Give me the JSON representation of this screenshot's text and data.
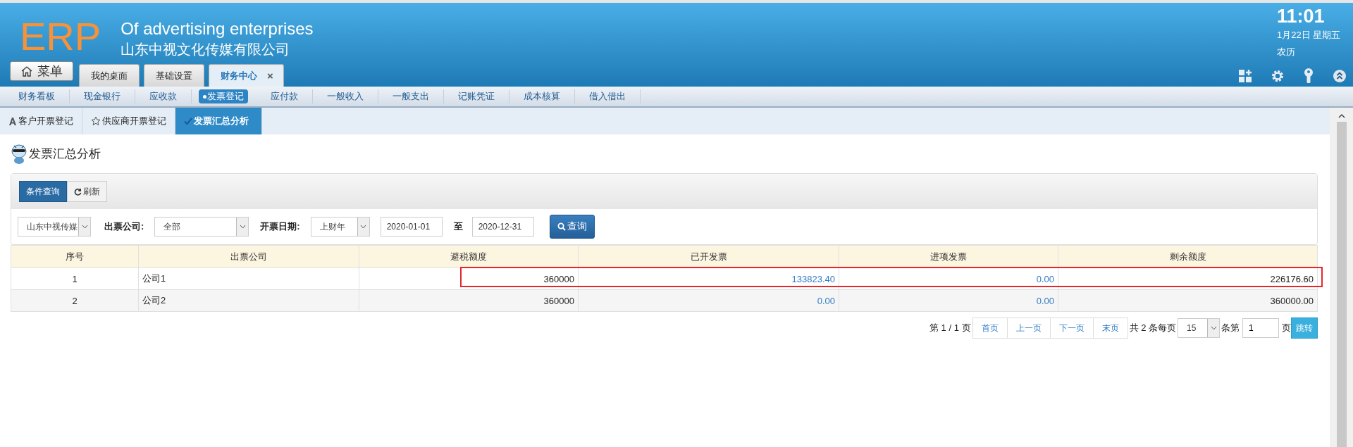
{
  "header": {
    "logo": "ERP",
    "title": "Of advertising enterprises",
    "company": "山东中视文化传媒有限公司",
    "menu_button": "菜单",
    "clock": {
      "time": "11:01",
      "date": "1月22日 星期五",
      "lunar": "农历"
    }
  },
  "top_tabs": [
    {
      "label": "我的桌面",
      "selected": false,
      "closable": false
    },
    {
      "label": "基础设置",
      "selected": false,
      "closable": false
    },
    {
      "label": "财务中心",
      "selected": true,
      "closable": true
    }
  ],
  "close_mark": "×",
  "nav": [
    {
      "label": "财务看板",
      "selected": false
    },
    {
      "label": "现金银行",
      "selected": false
    },
    {
      "label": "应收款",
      "selected": false
    },
    {
      "label": "发票登记",
      "selected": true
    },
    {
      "label": "应付款",
      "selected": false
    },
    {
      "label": "一般收入",
      "selected": false
    },
    {
      "label": "一般支出",
      "selected": false
    },
    {
      "label": "记账凭证",
      "selected": false
    },
    {
      "label": "成本核算",
      "selected": false
    },
    {
      "label": "借入借出",
      "selected": false
    }
  ],
  "sub_tabs": [
    {
      "label": "客户开票登记",
      "selected": false
    },
    {
      "label": "供应商开票登记",
      "selected": false
    },
    {
      "label": "发票汇总分析",
      "selected": true
    }
  ],
  "page_title": "发票汇总分析",
  "toolbar": [
    {
      "label": "条件查询",
      "selected": true
    },
    {
      "label": "刷新",
      "selected": false
    }
  ],
  "filters": {
    "org": "山东中视传媒",
    "company_label": "出票公司:",
    "company": "全部",
    "date_label": "开票日期:",
    "period": "上财年",
    "from": "2020-01-01",
    "to_label": "至",
    "to": "2020-12-31",
    "search_button": "查询"
  },
  "table": {
    "columns": [
      "序号",
      "出票公司",
      "避税额度",
      "已开发票",
      "进项发票",
      "剩余额度"
    ],
    "rows": [
      {
        "cells": [
          "1",
          "公司1",
          "360000",
          "133823.40",
          "0.00",
          "226176.60"
        ],
        "highlighted": true
      },
      {
        "cells": [
          "2",
          "公司2",
          "360000",
          "0.00",
          "0.00",
          "360000.00"
        ],
        "highlighted": false
      }
    ]
  },
  "pagination": {
    "page_info": "第 1 / 1 页",
    "buttons": [
      "首页",
      "上一页",
      "下一页",
      "末页"
    ],
    "total": "共 2 条每页",
    "page_size": "15",
    "page_label": "条第",
    "page": "1",
    "page_suffix": "页",
    "go": "跳转"
  }
}
